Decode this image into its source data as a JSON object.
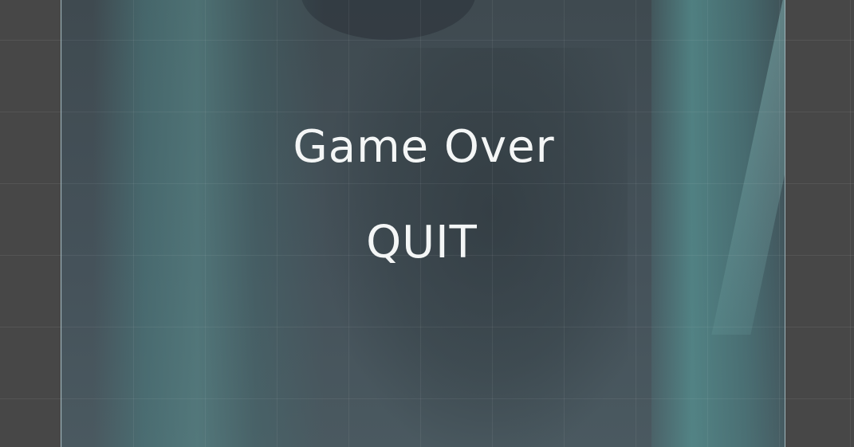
{
  "screen": {
    "title": "Game Over",
    "quit_label": "QUIT"
  },
  "colors": {
    "editor_background": "#474747",
    "canvas_tint": "#45525a",
    "text": "#f4f6f6",
    "canvas_border": "#bed7dc"
  }
}
